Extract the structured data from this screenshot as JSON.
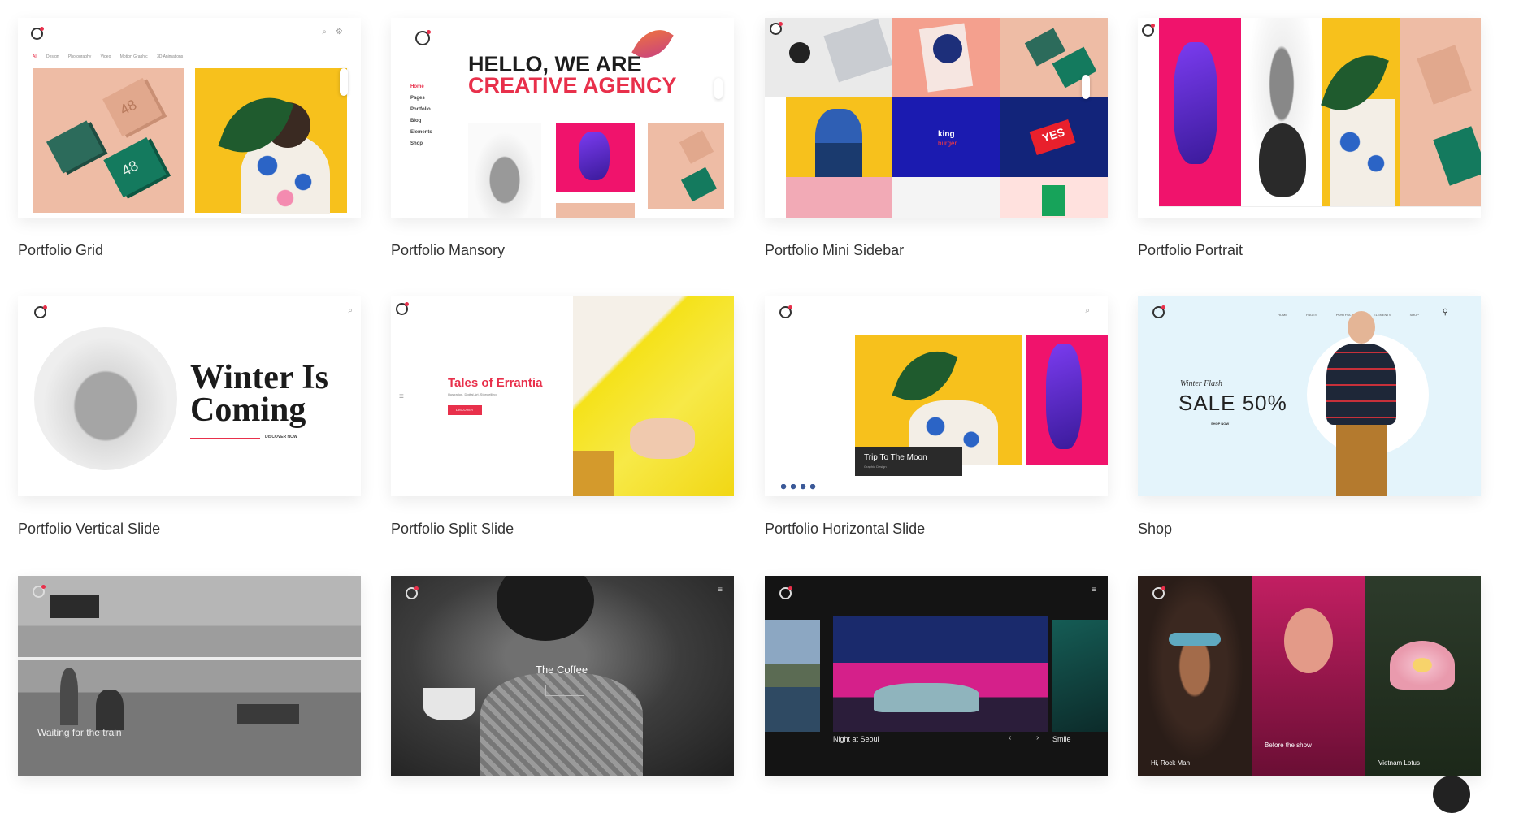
{
  "cards": [
    {
      "caption": "Portfolio Grid",
      "nav": [
        "All",
        "Design",
        "Photography",
        "Video",
        "Motion Graphic",
        "3D Animations"
      ],
      "badge": "48"
    },
    {
      "caption": "Portfolio Mansory",
      "hero_line1": "HELLO, WE ARE",
      "hero_line2": "CREATIVE AGENCY",
      "menu": [
        "Home",
        "Pages",
        "Portfolio",
        "Blog",
        "Elements",
        "Shop"
      ]
    },
    {
      "caption": "Portfolio Mini Sidebar",
      "brand": "king",
      "sub": "burger",
      "can": "YES"
    },
    {
      "caption": "Portfolio Portrait"
    },
    {
      "caption": "Portfolio Vertical Slide",
      "title_line1": "Winter Is",
      "title_line2": "Coming",
      "cta": "DISCOVER NOW"
    },
    {
      "caption": "Portfolio Split Slide",
      "title": "Tales of Errantia",
      "subtitle": "Illustration, Digital Art, Storytelling",
      "cta": "DISCOVER"
    },
    {
      "caption": "Portfolio Horizontal Slide",
      "overlay_title": "Trip To The Moon",
      "overlay_sub": "Graphic Design"
    },
    {
      "caption": "Shop",
      "kicker": "Winter Flash",
      "headline": "SALE 50%",
      "cta": "SHOP NOW",
      "nav": [
        "HOME",
        "PAGES",
        "PORTFOLIO",
        "ELEMENTS",
        "SHOP"
      ]
    },
    {
      "caption": "",
      "overlay": "Waiting for the train"
    },
    {
      "caption": "",
      "overlay_title": "The Coffee"
    },
    {
      "caption": "",
      "overlay_title": "Night at Seoul",
      "side_title": "Smile"
    },
    {
      "caption": "",
      "labels": [
        "Hi, Rock Man",
        "Before the show",
        "Vietnam Lotus"
      ]
    }
  ]
}
